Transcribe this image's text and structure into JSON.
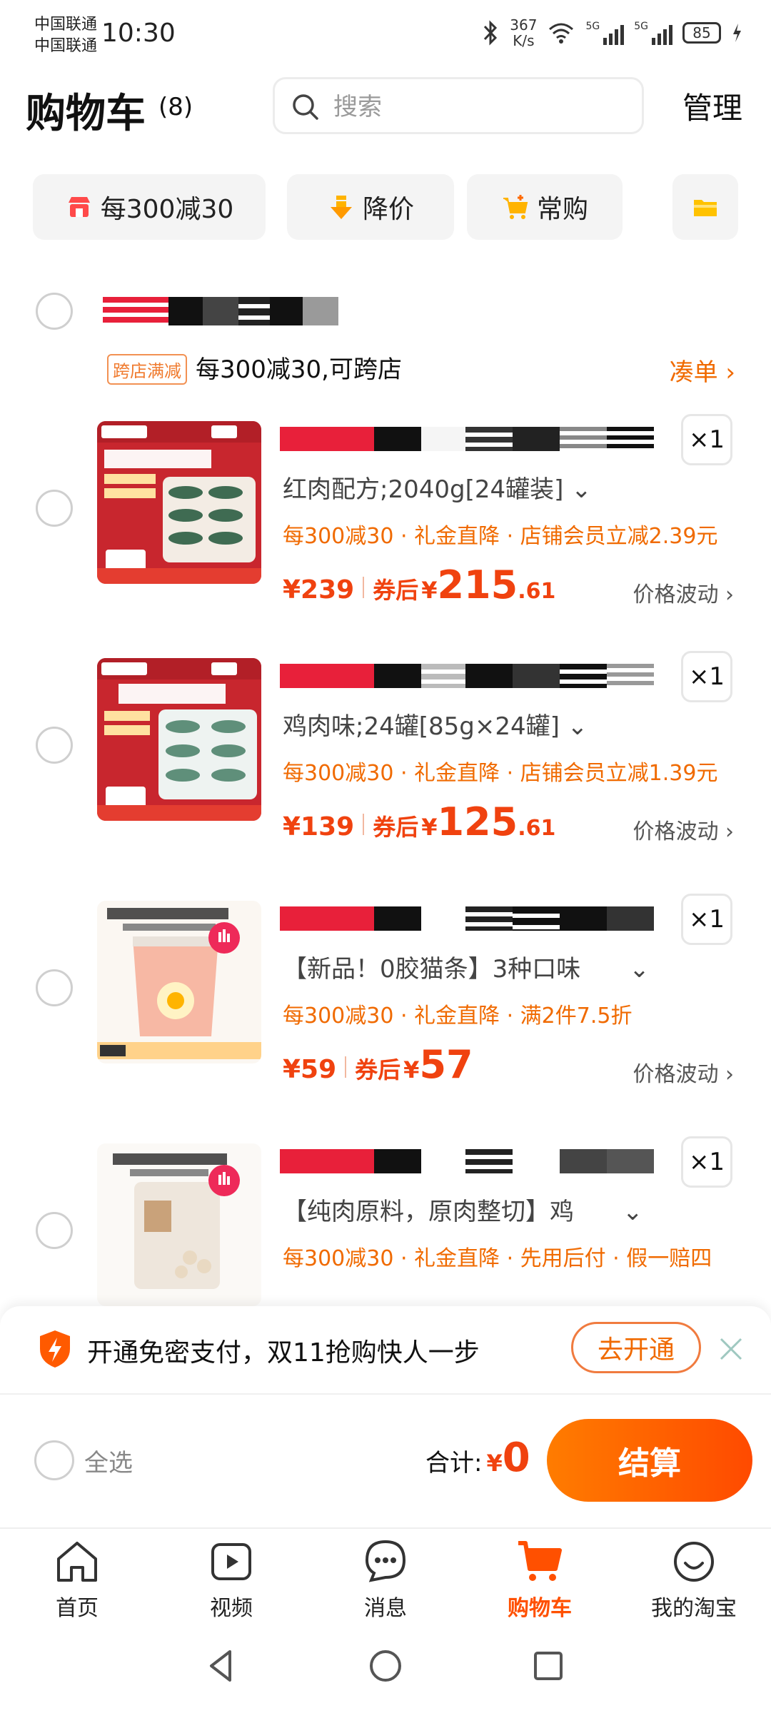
{
  "status_bar": {
    "carrier1": "中国联通",
    "carrier2": "中国联通",
    "time": "10:30",
    "net_speed_value": "367",
    "net_speed_unit": "K/s",
    "net1": "5G",
    "net2": "5G",
    "battery": "85"
  },
  "header": {
    "title": "购物车",
    "count": "(8)",
    "search_placeholder": "搜索",
    "manage": "管理"
  },
  "chips": [
    {
      "label": "每300减30",
      "icon": "shop-icon"
    },
    {
      "label": "降价",
      "icon": "price-drop-icon"
    },
    {
      "label": "常购",
      "icon": "cart-plus-icon"
    },
    {
      "label": "",
      "icon": "folder-icon"
    }
  ],
  "shop": {
    "promo_tag": "跨店满减",
    "promo_text": "每300减30,可跨店",
    "add_order": "凑单 ›"
  },
  "items": [
    {
      "qty": "×1",
      "spec": "红肉配方;2040g[24罐装] ⌄",
      "promos": "每300减30 · 礼金直降 · 店铺会员立减2.39元",
      "price": "¥239",
      "after_label": "券后",
      "after_yen": "¥",
      "after_int": "215",
      "after_dec": ".61",
      "fluct": "价格波动 ›"
    },
    {
      "qty": "×1",
      "spec": "鸡肉味;24罐[85g×24罐] ⌄",
      "promos": "每300减30 · 礼金直降 · 店铺会员立减1.39元",
      "price": "¥139",
      "after_label": "券后",
      "after_yen": "¥",
      "after_int": "125",
      "after_dec": ".61",
      "fluct": "价格波动 ›"
    },
    {
      "qty": "×1",
      "spec": "【新品！0胶猫条】3种口味　　⌄",
      "promos": "每300减30 · 礼金直降 · 满2件7.5折",
      "price": "¥59",
      "after_label": "券后",
      "after_yen": "¥",
      "after_int": "57",
      "after_dec": "",
      "fluct": "价格波动 ›"
    },
    {
      "qty": "×1",
      "spec": "【纯肉原料，原肉整切】鸡　　⌄",
      "promos": "每300减30 · 礼金直降 · 先用后付 · 假一赔四",
      "price": "",
      "after_label": "",
      "after_yen": "",
      "after_int": "",
      "after_dec": "",
      "fluct": ""
    }
  ],
  "notice": {
    "text": "开通免密支付，双11抢购快人一步",
    "button": "去开通"
  },
  "checkout": {
    "select_all": "全选",
    "total_label": "合计:",
    "total_yen": "¥",
    "total_amount": "0",
    "settle": "结算"
  },
  "tabs": [
    {
      "label": "首页",
      "icon": "home-icon"
    },
    {
      "label": "视频",
      "icon": "video-icon"
    },
    {
      "label": "消息",
      "icon": "message-icon"
    },
    {
      "label": "购物车",
      "icon": "cart-icon",
      "active": true
    },
    {
      "label": "我的淘宝",
      "icon": "profile-icon"
    }
  ],
  "colors": {
    "accent": "#ff5000",
    "price": "#f0420f",
    "promo": "#f06a00"
  }
}
